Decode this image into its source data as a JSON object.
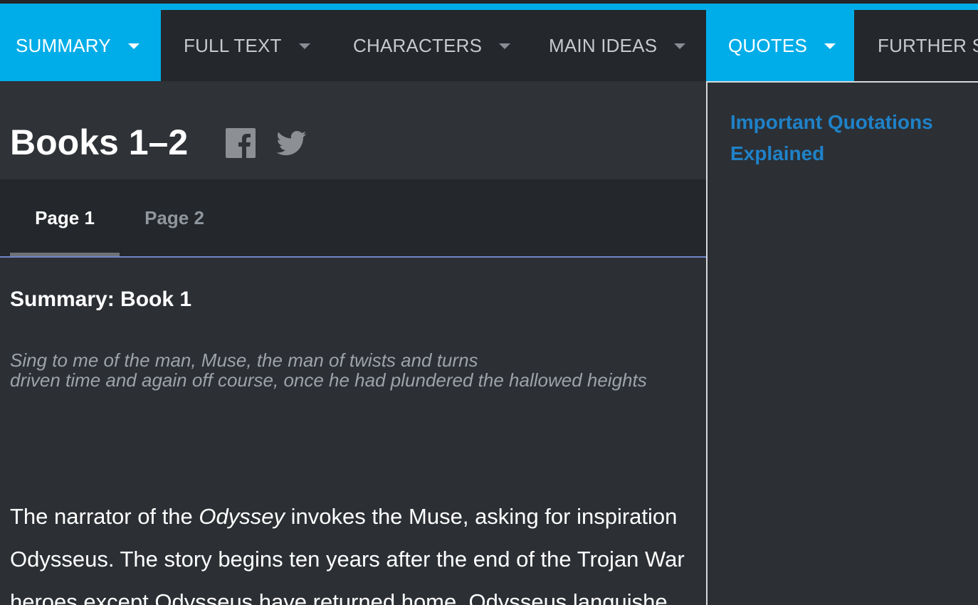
{
  "nav": {
    "items": [
      {
        "label": "SUMMARY",
        "has_caret": true,
        "active": true
      },
      {
        "label": "FULL TEXT",
        "has_caret": true,
        "active": false
      },
      {
        "label": "CHARACTERS",
        "has_caret": true,
        "active": false
      },
      {
        "label": "MAIN IDEAS",
        "has_caret": true,
        "active": false
      },
      {
        "label": "QUOTES",
        "has_caret": true,
        "active": true
      },
      {
        "label": "FURTHER S",
        "has_caret": false,
        "active": false
      }
    ]
  },
  "page": {
    "title": "Books 1–2",
    "social": [
      "facebook-icon",
      "twitter-icon"
    ],
    "tabs": [
      {
        "label": "Page 1",
        "active": true
      },
      {
        "label": "Page 2",
        "active": false
      }
    ],
    "section_heading": "Summary: Book 1",
    "poem_lines": [
      "Sing to me of the man, Muse, the man of twists and turns",
      "driven time and again off course, once he had plundered the hallowed heights"
    ],
    "body_lines": [
      "The narrator of the",
      "Odyssey",
      "invokes the Muse, asking for inspiration",
      "Odysseus. The story begins ten years after the end of the Trojan War",
      "heroes except Odysseus have returned home. Odysseus languishe"
    ]
  },
  "sidebar": {
    "link": "Important Quotations Explained"
  },
  "colors": {
    "accent": "#00ade8",
    "nav_bg": "#24272b",
    "page_bg": "#2c2f34",
    "link": "#1f82c8",
    "tab_underline": "#6f85c9"
  }
}
